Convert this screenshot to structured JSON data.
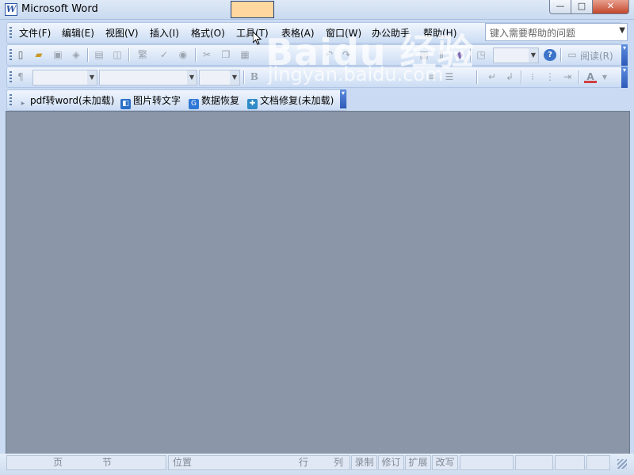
{
  "window": {
    "title": "Microsoft Word",
    "app_icon_letter": "W"
  },
  "window_controls": {
    "minimize": "—",
    "maximize": "□",
    "close": "✕"
  },
  "menu": {
    "items": [
      {
        "label": "文件(F)"
      },
      {
        "label": "编辑(E)"
      },
      {
        "label": "视图(V)"
      },
      {
        "label": "插入(I)"
      },
      {
        "label": "格式(O)"
      },
      {
        "label": "工具(T)",
        "state": "hover"
      },
      {
        "label": "表格(A)"
      },
      {
        "label": "窗口(W)"
      },
      {
        "label": "办公助手"
      },
      {
        "label": "帮助(H)"
      }
    ]
  },
  "help_search": {
    "placeholder": "键入需要帮助的问题"
  },
  "standard_toolbar": {
    "read_label": "阅读(R)"
  },
  "formatting_toolbar": {
    "bold": "B",
    "font_color": "A"
  },
  "plugin_toolbar": {
    "items": [
      {
        "label": "pdf转word(未加载)",
        "icon": "pdf-icon"
      },
      {
        "label": "图片转文字",
        "icon": "ocr-icon",
        "color": "#2b6fc7"
      },
      {
        "label": "数据恢复",
        "icon": "recovery-icon",
        "color": "#2f77d6"
      },
      {
        "label": "文档修复(未加载)",
        "icon": "repair-icon",
        "color": "#2e8bc8"
      }
    ]
  },
  "status_bar": {
    "page": "页",
    "section": "节",
    "position": "位置",
    "line": "行",
    "column": "列",
    "record": "录制",
    "revise": "修订",
    "extend": "扩展",
    "overtype": "改写"
  },
  "watermark": {
    "main": "Baidu 经验",
    "sub": "jingyan.baidu.com"
  },
  "colors": {
    "doc_background": "#8b97a8",
    "hover_highlight": "#ffd79f",
    "close_button": "#c3472c",
    "toolbar_gradient_top": "#f1f6fd",
    "toolbar_gradient_bottom": "#cbdcf3"
  }
}
